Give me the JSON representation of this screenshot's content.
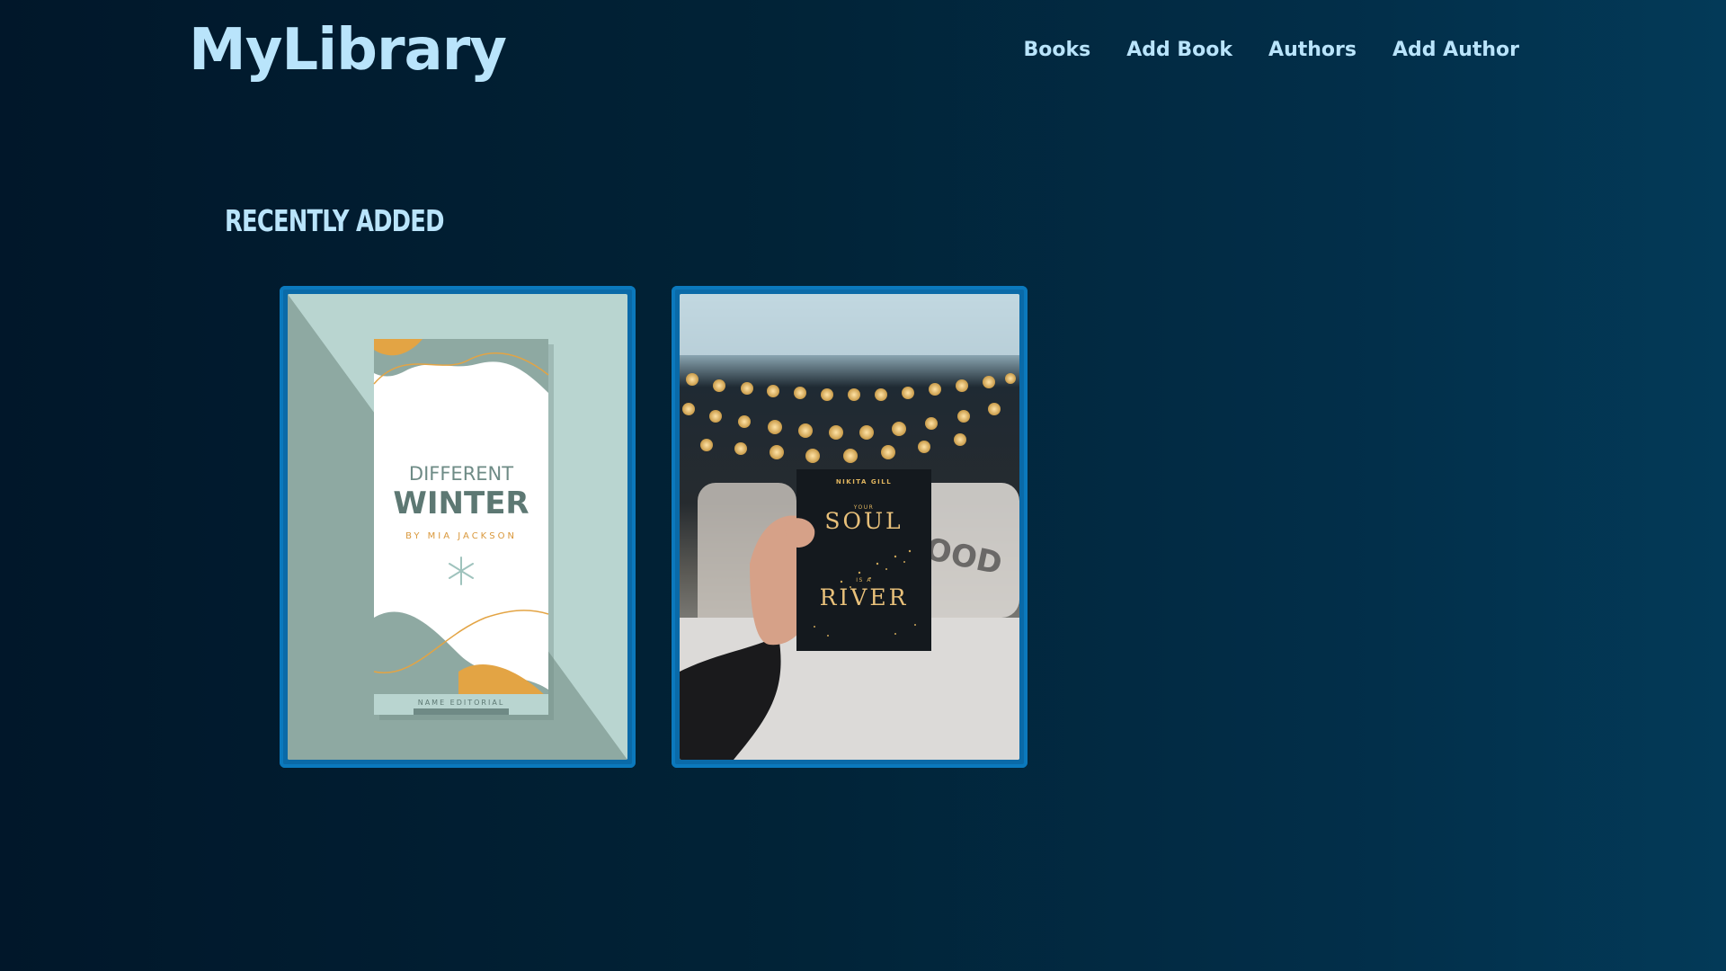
{
  "header": {
    "brand": "MyLibrary",
    "nav": [
      "Books",
      "Add Book",
      "Authors",
      "Add Author"
    ]
  },
  "main": {
    "section_title": "Recently Added",
    "books": [
      {
        "cover_line1": "DIFFERENT",
        "cover_line2": "WINTER",
        "cover_author": "BY MIA JACKSON",
        "cover_publisher": "NAME EDITORIAL"
      },
      {
        "cover_author": "NIKITA GILL",
        "cover_small1": "YOUR",
        "cover_line1": "SOUL",
        "cover_small2": "IS A",
        "cover_line2": "RIVER"
      }
    ]
  },
  "colors": {
    "accent_text": "#b9e4fb",
    "card_border": "#0b79bd",
    "background": "#012337"
  }
}
